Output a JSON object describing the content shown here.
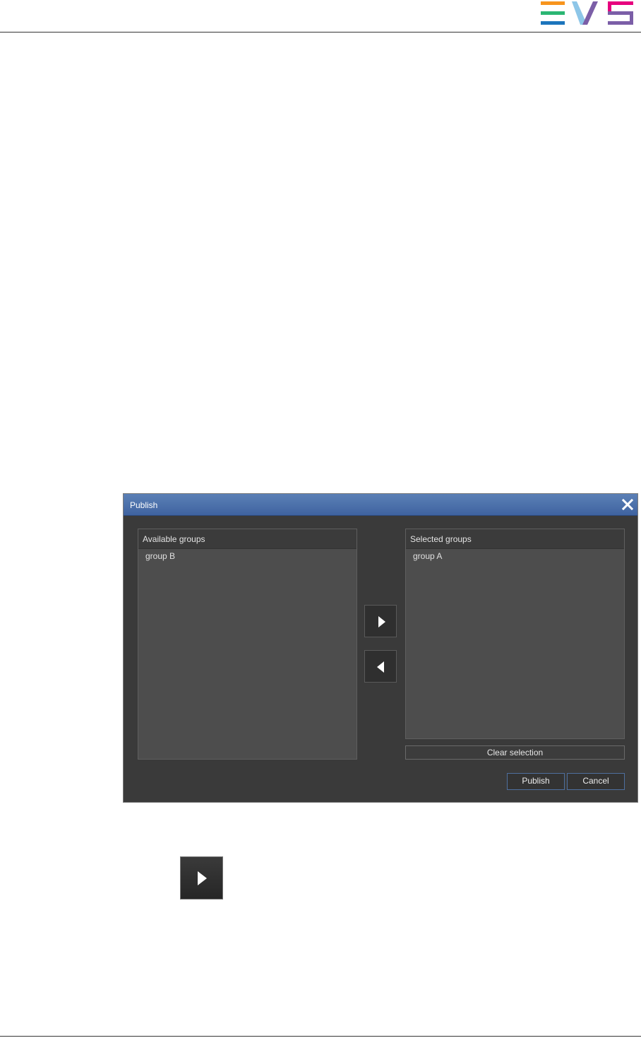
{
  "brand": {
    "logo_text": "EVS",
    "colors": [
      "#f39c12",
      "#2bb673",
      "#1c75bc",
      "#8dc6e8",
      "#7b5ea7",
      "#e6007e",
      "#f7941d"
    ]
  },
  "dialog": {
    "title": "Publish",
    "close_icon": "close-icon",
    "available": {
      "header": "Available groups",
      "items": [
        "group B"
      ]
    },
    "selected": {
      "header": "Selected groups",
      "items": [
        "group A"
      ]
    },
    "move_right_icon": "arrow-right-icon",
    "move_left_icon": "arrow-left-icon",
    "clear_label": "Clear selection",
    "publish_label": "Publish",
    "cancel_label": "Cancel"
  },
  "standalone": {
    "icon": "arrow-right-icon"
  }
}
